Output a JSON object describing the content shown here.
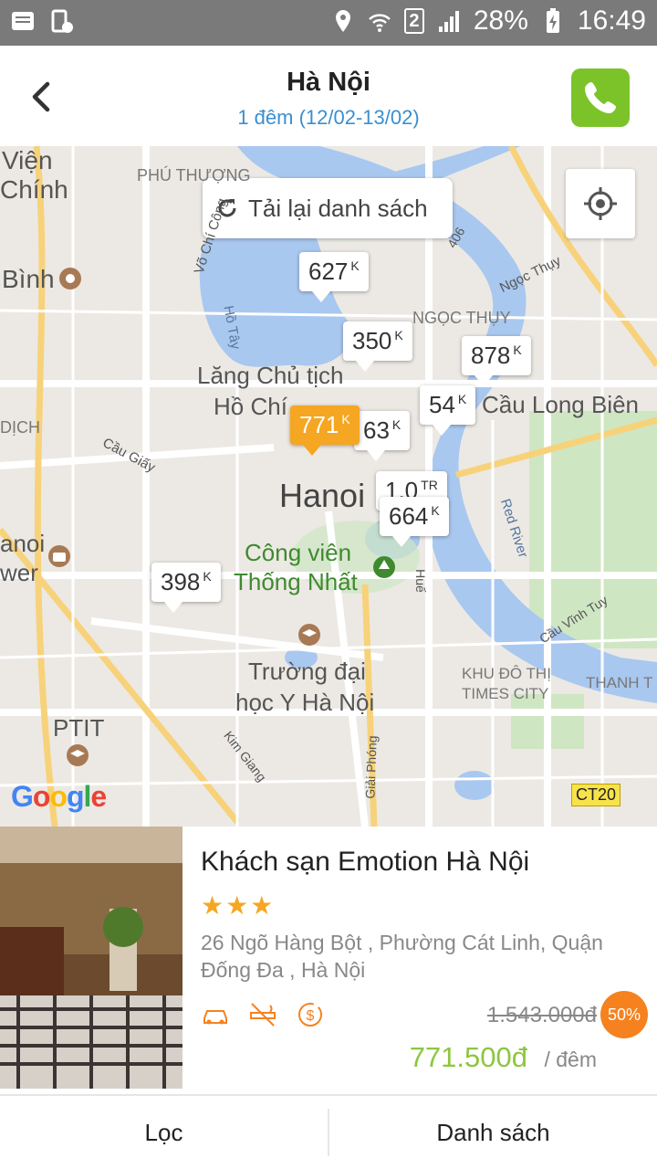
{
  "status_bar": {
    "battery": "28%",
    "time": "16:49",
    "sim_slot": "2"
  },
  "header": {
    "title": "Hà Nội",
    "subtitle": "1 đêm (12/02-13/02)"
  },
  "map": {
    "reload_label": "Tải lại danh sách",
    "labels": {
      "vien_chinh_1": "Viện",
      "vien_chinh_2": "Chính",
      "phu_thuong": "PHÚ THƯỢNG",
      "binh": "Bình",
      "vo_chi_cong": "Võ Chí Công",
      "ho_tay": "Hồ Tây",
      "ngoc_thuy_road": "Ngọc Thụy",
      "ngoc_thuy": "NGỌC THỤY",
      "road_406": "406",
      "lang_1": "Lăng Chủ tịch",
      "lang_2": "Hồ Chí",
      "dich": "DỊCH",
      "cau_giay": "Cầu Giấy",
      "cau_long_bien": "Cầu Long Biên",
      "hanoi": "Hanoi",
      "cong_vien_1": "Công viên",
      "cong_vien_2": "Thống Nhất",
      "hue": "Huế",
      "red_river": "Red River",
      "hanoi_tower_1": "anoi",
      "hanoi_tower_2": "wer",
      "cau_vinh_tuy": "Cầu Vĩnh Tuy",
      "truong_1": "Trường đại",
      "truong_2": "học Y Hà Nội",
      "khu_do_thi_1": "KHU ĐÔ THỊ",
      "khu_do_thi_2": "TIMES CITY",
      "thanh_tri": "THANH T",
      "ptit": "PTIT",
      "kim_giang": "Kim Giang",
      "giai_phong": "Giải Phóng",
      "ct20": "CT20",
      "google": "Google"
    },
    "price_pins": [
      {
        "value": "627",
        "unit": "K"
      },
      {
        "value": "350",
        "unit": "K"
      },
      {
        "value": "878",
        "unit": "K"
      },
      {
        "value": "54",
        "unit": "K"
      },
      {
        "value": "63",
        "unit": "K"
      },
      {
        "value": "771",
        "unit": "K"
      },
      {
        "value": "1,0",
        "unit": "TR"
      },
      {
        "value": "664",
        "unit": "K"
      },
      {
        "value": "398",
        "unit": "K"
      }
    ]
  },
  "hotel": {
    "name": "Khách sạn Emotion Hà Nội",
    "stars": "★★★",
    "star_count": 3,
    "address": "26 Ngõ Hàng Bột , Phường Cát Linh, Quận Đống Đa , Hà Nội",
    "old_price": "1.543.000đ",
    "discount": "50%",
    "price": "771.500đ",
    "per_night": "/ đêm",
    "amenities": [
      "car-icon",
      "no-smoking-icon",
      "money-icon"
    ]
  },
  "bottom_bar": {
    "filter_label": "Lọc",
    "list_label": "Danh sách"
  },
  "colors": {
    "accent_green": "#7cc32a",
    "price_green": "#8dc63f",
    "pin_active": "#f5a623",
    "discount": "#f5821f",
    "subtitle_blue": "#3a8fd0",
    "water": "#a9c8f0"
  }
}
